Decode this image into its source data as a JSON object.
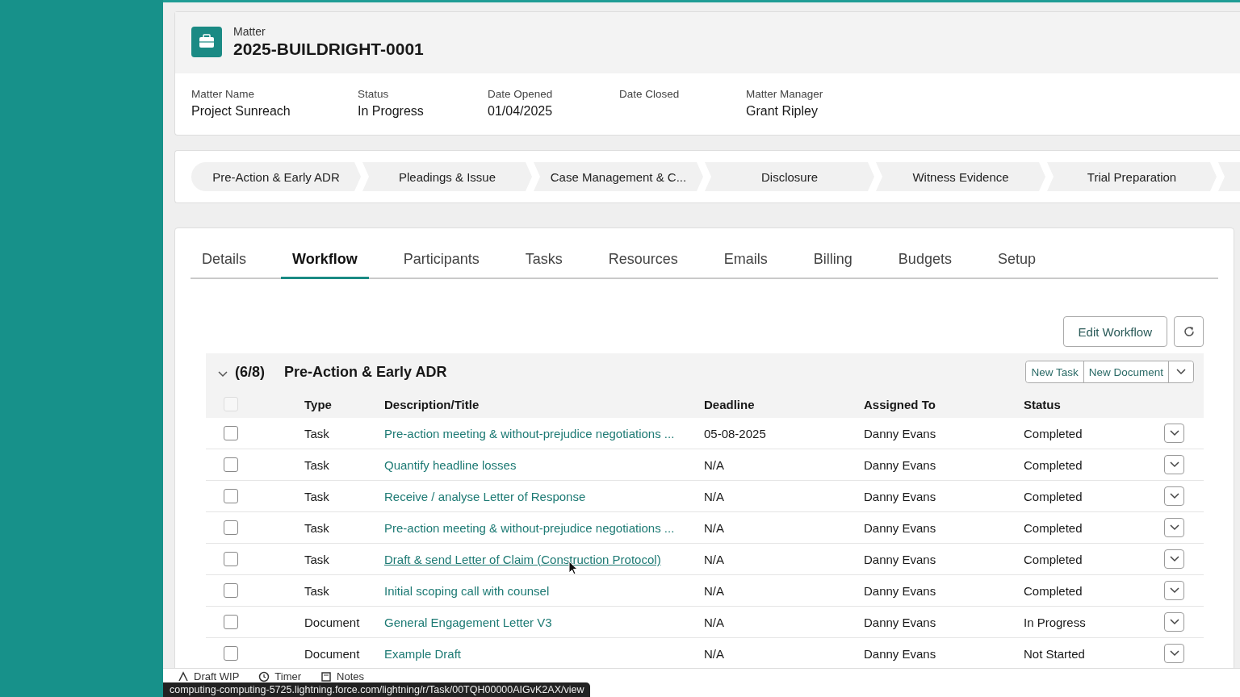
{
  "record": {
    "object_label": "Matter",
    "title": "2025-BUILDRIGHT-0001"
  },
  "fields": [
    {
      "label": "Matter Name",
      "value": "Project Sunreach"
    },
    {
      "label": "Status",
      "value": "In Progress"
    },
    {
      "label": "Date Opened",
      "value": "01/04/2025"
    },
    {
      "label": "Date Closed"
    },
    {
      "label": "Matter Manager",
      "value": "Grant Ripley"
    }
  ],
  "path_steps": [
    "Pre-Action & Early ADR",
    "Pleadings & Issue",
    "Case Management & C...",
    "Disclosure",
    "Witness Evidence",
    "Trial Preparation"
  ],
  "tabs": [
    {
      "label": "Details",
      "selected": false
    },
    {
      "label": "Workflow",
      "selected": true
    },
    {
      "label": "Participants",
      "selected": false
    },
    {
      "label": "Tasks",
      "selected": false
    },
    {
      "label": "Resources",
      "selected": false
    },
    {
      "label": "Emails",
      "selected": false
    },
    {
      "label": "Billing",
      "selected": false
    },
    {
      "label": "Budgets",
      "selected": false
    },
    {
      "label": "Setup",
      "selected": false
    }
  ],
  "actions": {
    "edit_button": "Edit Workflow"
  },
  "stage": {
    "expanded": true,
    "count": "(6/8)",
    "title": "Pre-Action & Early ADR",
    "buttons": [
      "New Task",
      "New Document"
    ],
    "select_all": {
      "checked": false,
      "disabled": true
    },
    "columns": [
      "Type",
      "Description/Title",
      "Deadline",
      "Assigned To",
      "Status"
    ],
    "rows": [
      {
        "checked": false,
        "type": "Task",
        "title": "Pre-action meeting & without-prejudice negotiations ...",
        "deadline": "05-08-2025",
        "assigned_to": "Danny Evans",
        "status": "Completed"
      },
      {
        "checked": false,
        "type": "Task",
        "title": "Quantify headline losses",
        "deadline": "N/A",
        "assigned_to": "Danny Evans",
        "status": "Completed"
      },
      {
        "checked": false,
        "type": "Task",
        "title": "Receive / analyse Letter of Response",
        "deadline": "N/A",
        "assigned_to": "Danny Evans",
        "status": "Completed"
      },
      {
        "checked": false,
        "type": "Task",
        "title": "Pre-action meeting & without-prejudice negotiations ...",
        "deadline": "N/A",
        "assigned_to": "Danny Evans",
        "status": "Completed"
      },
      {
        "checked": false,
        "type": "Task",
        "title": "Draft & send Letter of Claim (Construction Protocol)",
        "deadline": "N/A",
        "assigned_to": "Danny Evans",
        "status": "Completed",
        "hovered": true
      },
      {
        "checked": false,
        "type": "Task",
        "title": "Initial scoping call with counsel",
        "deadline": "N/A",
        "assigned_to": "Danny Evans",
        "status": "Completed"
      },
      {
        "checked": false,
        "type": "Document",
        "title": "General Engagement Letter V3",
        "deadline": "N/A",
        "assigned_to": "Danny Evans",
        "status": "In Progress"
      },
      {
        "checked": false,
        "type": "Document",
        "title": "Example Draft",
        "deadline": "N/A",
        "assigned_to": "Danny Evans",
        "status": "Not Started"
      }
    ]
  },
  "utility_bar": [
    "Draft WIP",
    "Timer",
    "Notes"
  ],
  "link_preview": "computing-computing-5725.lightning.force.com/lightning/r/Task/00TQH00000AIGvK2AX/view"
}
